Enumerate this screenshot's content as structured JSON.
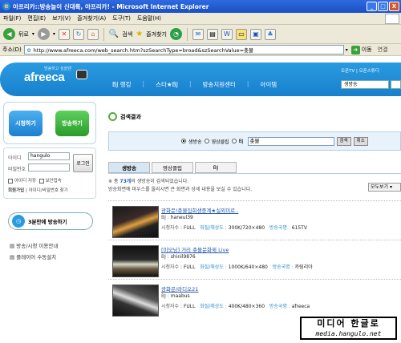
{
  "window": {
    "title": "아프리카::방송놀이 신대륙, 아프리카! - Microsoft Internet Explorer",
    "controls": [
      "_",
      "□",
      "X"
    ]
  },
  "menu": [
    "파일(F)",
    "편집(E)",
    "보기(V)",
    "즐겨찾기(A)",
    "도구(T)",
    "도움말(H)"
  ],
  "toolbar": {
    "back": "뒤로",
    "search": "검색",
    "favorites": "즐겨찾기"
  },
  "address": {
    "label": "주소(D)",
    "url": "http://www.afreeca.com/web_search.htm?szSearchType=broad&szSearchValue=촛불",
    "go": "이동",
    "links": "연결"
  },
  "site": {
    "logo": "afreeca",
    "tagline": "방송하고 싶을땐",
    "nav": [
      "BJ 랭킹",
      "스타★BJ",
      "방송지원센터",
      "아이템"
    ],
    "top_right": "오픈TV | 오픈스튜디",
    "select": "생방송"
  },
  "sidebar": {
    "watch": "시청하기",
    "broadcast": "방송하기",
    "id_label": "아이디",
    "id_value": "hangulo",
    "pw_label": "비밀번호",
    "login": "로그인",
    "save_id": "아이디 저장",
    "secure": "보안접속",
    "join": "회원가입",
    "find": "아이디/비밀번호 찾기",
    "promo": "3분만에 방송하기",
    "link1": "방송/시청 이용안내",
    "link2": "플레이어 수동설치"
  },
  "search": {
    "title": "검색결과",
    "options": [
      "생방송",
      "영상클립",
      "BJ"
    ],
    "query": "촛불",
    "search_btn": "검색",
    "reset_btn": "취소",
    "tabs": [
      "생방송",
      "영상클립",
      "BJ"
    ],
    "summary_pre": "※ 총",
    "summary_count": "73개",
    "summary_post": "의 생방송이 검색되었습니다.",
    "summary_line2": "방송화면에 마우스를 올리시면 큰 화면과 상세 내용을 보실 수 있습니다.",
    "sort": "모두보기"
  },
  "results": [
    {
      "title": "광화문!촛불집회생중계★실외미로..",
      "bj": "haneul39",
      "viewers": "FULL",
      "quality": "300K/720×480",
      "network": "615TV"
    },
    {
      "title": "[미모닝] 거리 촛불문화제 Live",
      "bj": "shinil9876",
      "viewers": "FULL",
      "quality": "1000K/640×480",
      "network": "카림리아"
    },
    {
      "title": "광화문/라디오21",
      "bj": "maabus",
      "viewers": "FULL",
      "quality": "400K/480×360",
      "network": "afreeca"
    }
  ],
  "result_labels": {
    "bj": "BJ :",
    "viewers": "시청자수 :",
    "quality": "화질/해상도 :",
    "network": "방송국명 :"
  },
  "watermark": {
    "line1": "미디어 한글로",
    "line2": "media.hangulo.net"
  }
}
